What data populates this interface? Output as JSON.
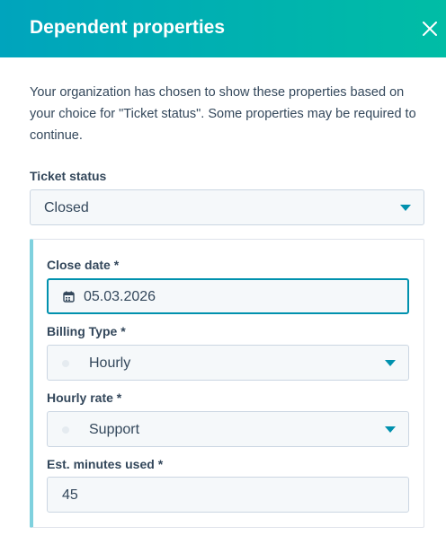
{
  "header": {
    "title": "Dependent properties",
    "close_icon": "close-icon"
  },
  "intro": "Your organization has chosen to show these properties based on your choice for \"Ticket status\". Some properties may be required to continue.",
  "ticket_status": {
    "label": "Ticket status",
    "value": "Closed"
  },
  "dependent": {
    "close_date": {
      "label": "Close date *",
      "value": "05.03.2026",
      "icon": "calendar-icon"
    },
    "billing_type": {
      "label": "Billing Type *",
      "value": "Hourly"
    },
    "hourly_rate": {
      "label": "Hourly rate *",
      "value": "Support"
    },
    "est_minutes": {
      "label": "Est. minutes used *",
      "value": "45"
    }
  },
  "colors": {
    "header_start": "#00a4bd",
    "header_end": "#00bda5",
    "text": "#33475b",
    "focus_border": "#0091ae",
    "panel_accent": "#7fd1de",
    "caret": "#0091ae"
  }
}
